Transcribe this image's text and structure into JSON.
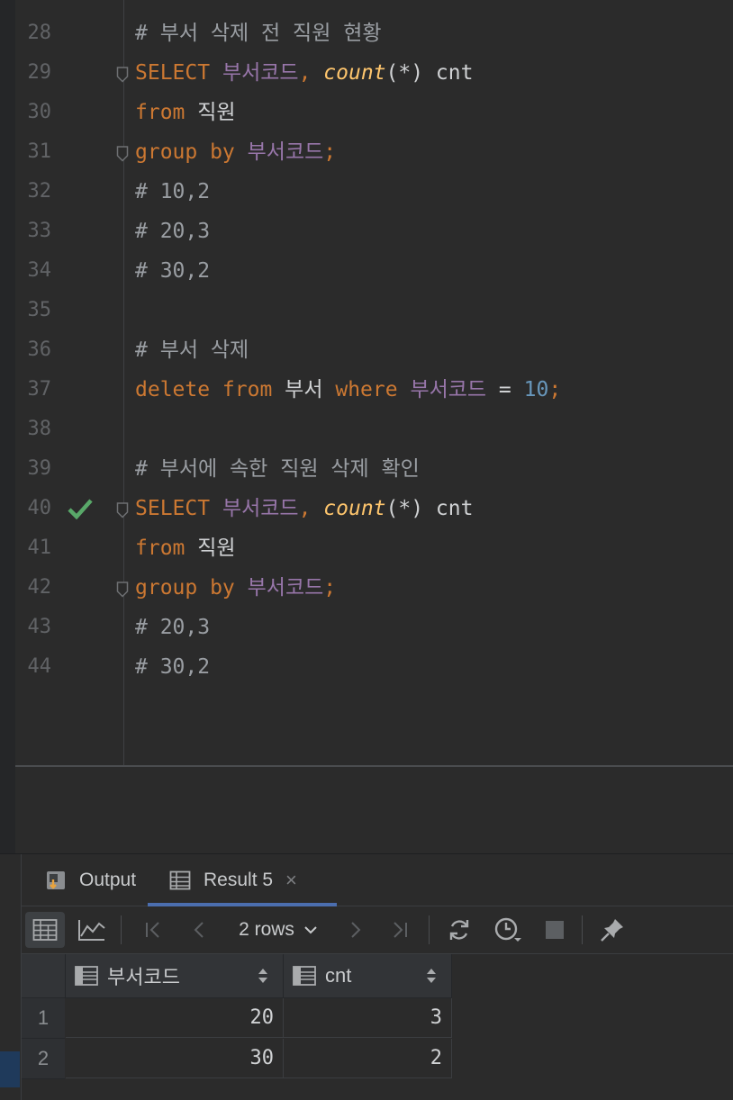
{
  "editor": {
    "lines": [
      {
        "num": "28",
        "tokens": [
          {
            "t": "# 부서 삭제 전 직원 현황",
            "c": "cmt"
          }
        ]
      },
      {
        "num": "29",
        "fold": true,
        "tokens": [
          {
            "t": "SELECT ",
            "c": "kw"
          },
          {
            "t": "부서코드",
            "c": "id"
          },
          {
            "t": ", ",
            "c": "kw"
          },
          {
            "t": "count",
            "c": "fn"
          },
          {
            "t": "(*) ",
            "c": "plain"
          },
          {
            "t": "cnt",
            "c": "plain"
          }
        ]
      },
      {
        "num": "30",
        "tokens": [
          {
            "t": "from ",
            "c": "kw"
          },
          {
            "t": "직원",
            "c": "plain"
          }
        ]
      },
      {
        "num": "31",
        "fold": true,
        "tokens": [
          {
            "t": "group by ",
            "c": "kw"
          },
          {
            "t": "부서코드",
            "c": "id"
          },
          {
            "t": ";",
            "c": "kw"
          }
        ]
      },
      {
        "num": "32",
        "tokens": [
          {
            "t": "# 10,2",
            "c": "cmt"
          }
        ]
      },
      {
        "num": "33",
        "tokens": [
          {
            "t": "# 20,3",
            "c": "cmt"
          }
        ]
      },
      {
        "num": "34",
        "tokens": [
          {
            "t": "# 30,2",
            "c": "cmt"
          }
        ]
      },
      {
        "num": "35",
        "tokens": []
      },
      {
        "num": "36",
        "tokens": [
          {
            "t": "# 부서 삭제",
            "c": "cmt"
          }
        ]
      },
      {
        "num": "37",
        "tokens": [
          {
            "t": "delete from ",
            "c": "kw"
          },
          {
            "t": "부서 ",
            "c": "plain"
          },
          {
            "t": "where ",
            "c": "kw"
          },
          {
            "t": "부서코드",
            "c": "id"
          },
          {
            "t": " = ",
            "c": "plain"
          },
          {
            "t": "10",
            "c": "num"
          },
          {
            "t": ";",
            "c": "kw"
          }
        ]
      },
      {
        "num": "38",
        "tokens": []
      },
      {
        "num": "39",
        "tokens": [
          {
            "t": "# 부서에 속한 직원 삭제 확인",
            "c": "cmt"
          }
        ]
      },
      {
        "num": "40",
        "fold": true,
        "check": true,
        "tokens": [
          {
            "t": "SELECT ",
            "c": "kw"
          },
          {
            "t": "부서코드",
            "c": "id"
          },
          {
            "t": ", ",
            "c": "kw"
          },
          {
            "t": "count",
            "c": "fn"
          },
          {
            "t": "(*) ",
            "c": "plain"
          },
          {
            "t": "cnt",
            "c": "plain"
          }
        ]
      },
      {
        "num": "41",
        "tokens": [
          {
            "t": "from ",
            "c": "kw"
          },
          {
            "t": "직원",
            "c": "plain"
          }
        ]
      },
      {
        "num": "42",
        "fold": true,
        "tokens": [
          {
            "t": "group by ",
            "c": "kw"
          },
          {
            "t": "부서코드",
            "c": "id"
          },
          {
            "t": ";",
            "c": "kw"
          }
        ]
      },
      {
        "num": "43",
        "tokens": [
          {
            "t": "# 20,3",
            "c": "cmt"
          }
        ]
      },
      {
        "num": "44",
        "tokens": [
          {
            "t": "# 30,2",
            "c": "cmt"
          }
        ]
      }
    ]
  },
  "tabs": {
    "output_label": "Output",
    "result_label": "Result 5",
    "close_glyph": "×"
  },
  "toolbar": {
    "rows_label": "2 rows"
  },
  "results": {
    "columns": [
      "부서코드",
      "cnt"
    ],
    "rows": [
      {
        "num": "1",
        "values": [
          "20",
          "3"
        ]
      },
      {
        "num": "2",
        "values": [
          "30",
          "2"
        ]
      }
    ]
  },
  "colors": {
    "keyword": "#cc7832",
    "identifier": "#9876aa",
    "function": "#ffc66d",
    "number": "#6897bb",
    "check": "#59a869",
    "active_tab": "#4b6eaf"
  }
}
